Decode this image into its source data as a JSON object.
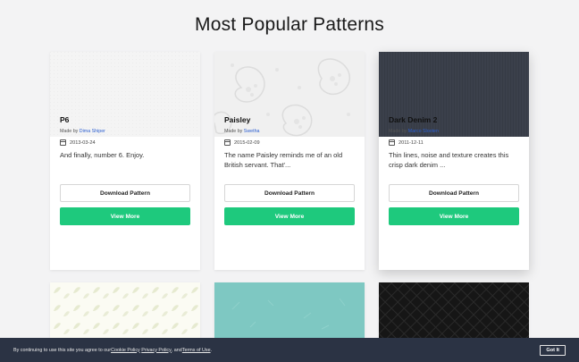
{
  "page": {
    "title": "Most Popular Patterns"
  },
  "cards": [
    {
      "name": "P6",
      "made_by_prefix": "Made by ",
      "author": "Dima Shiper",
      "date": "2013-03-24",
      "description": "And finally, number 6. Enjoy.",
      "download_label": "Download Pattern",
      "view_label": "View More",
      "pattern": "p6-light-gray"
    },
    {
      "name": "Paisley",
      "made_by_prefix": "Made by ",
      "author": "Swetha",
      "date": "2015-02-09",
      "description": "The name Paisley reminds me of an old British servant. That'...",
      "download_label": "Download Pattern",
      "view_label": "View More",
      "pattern": "paisley"
    },
    {
      "name": "Dark Denim 2",
      "made_by_prefix": "Made by ",
      "author": "Marco Slooten",
      "date": "2011-12-11",
      "description": "Thin lines, noise and texture creates this crisp dark denim ...",
      "download_label": "Download Pattern",
      "view_label": "View More",
      "pattern": "dark-denim"
    }
  ],
  "partial_cards": [
    {
      "pattern": "leaves-light"
    },
    {
      "pattern": "teal-texture"
    },
    {
      "pattern": "dark-quilted"
    }
  ],
  "cookie_bar": {
    "text_before": "By continuing to use this site you agree to our ",
    "link_cookie": "Cookie Policy",
    "link_privacy": "Privacy Policy",
    "text_and": ", and ",
    "link_terms": "Terms of Use",
    "text_end": ".",
    "button_label": "Got It"
  },
  "colors": {
    "accent": "#1ec97d",
    "author_link": "#2c5fd1",
    "cookie_bar_bg": "#2b3344",
    "page_bg": "#f3f3f4"
  }
}
